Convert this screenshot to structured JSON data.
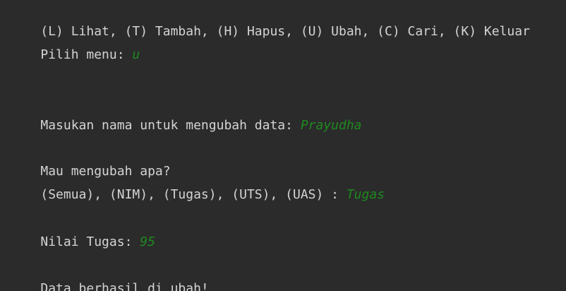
{
  "console": {
    "menu_options": "(L) Lihat, (T) Tambah, (H) Hapus, (U) Ubah, (C) Cari, (K) Keluar",
    "menu_prompt": "Pilih menu: ",
    "menu_input": "u",
    "name_prompt": "Masukan nama untuk mengubah data: ",
    "name_input": "Prayudha",
    "change_question": "Mau mengubah apa?",
    "change_options_prompt": "(Semua), (NIM), (Tugas), (UTS), (UAS) : ",
    "change_input": "Tugas",
    "value_prompt": "Nilai Tugas: ",
    "value_input": "95",
    "result_message": "Data berhasil di ubah!"
  },
  "colors": {
    "background": "#2b2b2b",
    "text": "#d4d4d4",
    "user_input": "#1f8a1f"
  }
}
